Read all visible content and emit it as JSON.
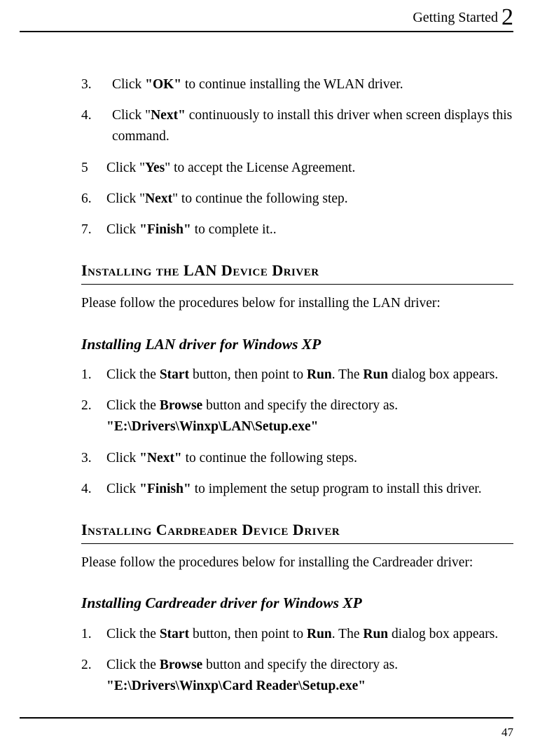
{
  "header": {
    "title": "Getting Started",
    "chapter": "2"
  },
  "steps_top": [
    {
      "n": "3.",
      "pre": "Click ",
      "bold": "\"OK\"",
      "post": " to continue installing the WLAN driver."
    },
    {
      "n": "4.",
      "pre": "Click \"",
      "bold": "Next\"",
      "post": " continuously to install this driver when screen displays this command."
    },
    {
      "n": "5",
      "pre": "Click \"",
      "bold": "Yes",
      "post": "\" to accept the License Agreement."
    },
    {
      "n": "6.",
      "pre": "Click \"",
      "bold": "Next",
      "post": "\" to continue the following step."
    },
    {
      "n": "7.",
      "pre": "Click ",
      "bold": "\"Finish\"",
      "post": " to complete it.."
    }
  ],
  "section_lan": {
    "heading": "Installing the LAN Device Driver",
    "intro": "Please follow the procedures below for installing the LAN driver:",
    "subhead": "Installing LAN driver for Windows XP",
    "steps": [
      {
        "n": "1.",
        "text_parts": [
          "Click the ",
          "Start",
          " button, then point to ",
          "Run",
          ". The ",
          "Run",
          " dialog box appears."
        ]
      },
      {
        "n": "2.",
        "line1_parts": [
          "Click the ",
          "Browse",
          " button and specify the directory as."
        ],
        "line2": "\"E:\\Drivers\\Winxp\\LAN\\Setup.exe\""
      },
      {
        "n": "3.",
        "simple_pre": "Click  ",
        "simple_bold": "\"Next\"",
        "simple_post": " to continue the following steps."
      },
      {
        "n": "4.",
        "simple_pre": "Click ",
        "simple_bold": "\"Finish\"",
        "simple_post": " to implement the setup program to install this driver."
      }
    ]
  },
  "section_card": {
    "heading": "Installing Cardreader Device Driver",
    "intro": "Please follow the procedures below for installing the Cardreader driver:",
    "subhead": "Installing Cardreader driver for Windows XP",
    "steps": [
      {
        "n": "1.",
        "text_parts": [
          "Click the ",
          "Start",
          " button, then point to ",
          "Run",
          ". The ",
          "Run",
          " dialog box appears."
        ]
      },
      {
        "n": "2.",
        "line1_parts": [
          "Click the ",
          "Browse",
          " button and specify the directory as."
        ],
        "line2": "\"E:\\Drivers\\Winxp\\Card Reader\\Setup.exe\""
      }
    ]
  },
  "page_number": "47"
}
